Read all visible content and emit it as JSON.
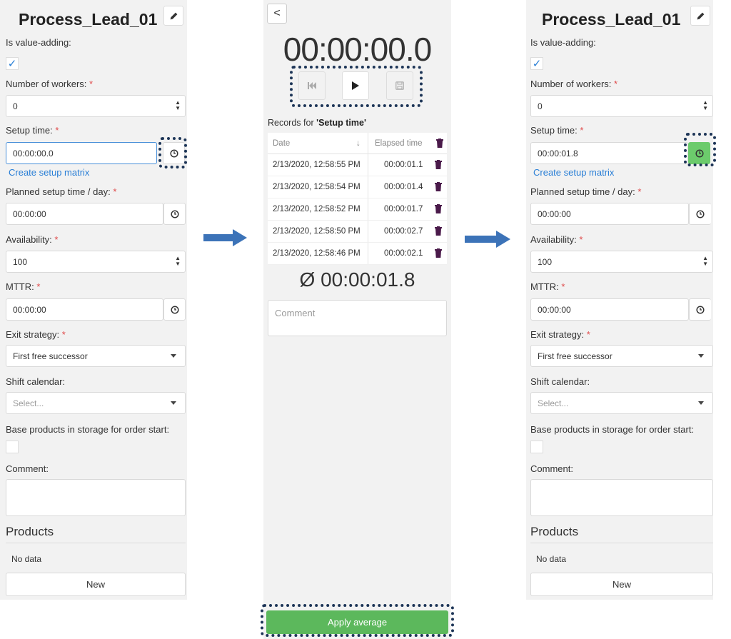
{
  "left_form": {
    "title": "Process_Lead_01",
    "value_adding_label": "Is value-adding:",
    "workers_label": "Number of workers:",
    "workers_value": "0",
    "setup_label": "Setup time:",
    "setup_value": "00:00:00.0",
    "setup_matrix_link": "Create setup matrix",
    "planned_label": "Planned setup time / day:",
    "planned_value": "00:00:00",
    "availability_label": "Availability:",
    "availability_value": "100",
    "mttr_label": "MTTR:",
    "mttr_value": "00:00:00",
    "exit_label": "Exit strategy:",
    "exit_value": "First free successor",
    "shift_label": "Shift calendar:",
    "shift_placeholder": "Select...",
    "base_label": "Base products in storage for order start:",
    "comment_label": "Comment:",
    "products_title": "Products",
    "no_data": "No data",
    "new_label": "New"
  },
  "right_form": {
    "title": "Process_Lead_01",
    "value_adding_label": "Is value-adding:",
    "workers_label": "Number of workers:",
    "workers_value": "0",
    "setup_label": "Setup time:",
    "setup_value": "00:00:01.8",
    "setup_matrix_link": "Create setup matrix",
    "planned_label": "Planned setup time / day:",
    "planned_value": "00:00:00",
    "availability_label": "Availability:",
    "availability_value": "100",
    "mttr_label": "MTTR:",
    "mttr_value": "00:00:00",
    "exit_label": "Exit strategy:",
    "exit_value": "First free successor",
    "shift_label": "Shift calendar:",
    "shift_placeholder": "Select...",
    "base_label": "Base products in storage for order start:",
    "comment_label": "Comment:",
    "products_title": "Products",
    "no_data": "No data",
    "new_label": "New"
  },
  "required_mark": "*",
  "checkmark": "✓",
  "stopwatch": {
    "back_label": "<",
    "timer": "00:00:00.0",
    "records_prefix": "Records for ",
    "records_target": "'Setup time'",
    "col_date": "Date",
    "sort_arrow": "↓",
    "col_elapsed": "Elapsed time",
    "records": [
      {
        "date": "2/13/2020, 12:58:55 PM",
        "elapsed": "00:00:01.1"
      },
      {
        "date": "2/13/2020, 12:58:54 PM",
        "elapsed": "00:00:01.4"
      },
      {
        "date": "2/13/2020, 12:58:52 PM",
        "elapsed": "00:00:01.7"
      },
      {
        "date": "2/13/2020, 12:58:50 PM",
        "elapsed": "00:00:02.7"
      },
      {
        "date": "2/13/2020, 12:58:46 PM",
        "elapsed": "00:00:02.1"
      }
    ],
    "average": "Ø 00:00:01.8",
    "comment_placeholder": "Comment",
    "apply_label": "Apply average"
  },
  "colors": {
    "accent_blue": "#2a7fd6",
    "arrow_blue": "#3c73b8",
    "success_green": "#5cb85c",
    "highlight_dots": "#1d3557",
    "required_red": "#e04a4a",
    "trash_purple": "#4a1a4a"
  }
}
